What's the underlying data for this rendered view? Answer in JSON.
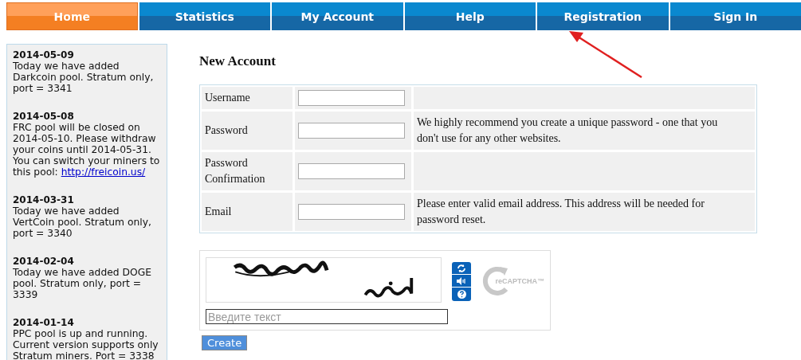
{
  "nav": [
    {
      "label": "Home",
      "selected": true
    },
    {
      "label": "Statistics",
      "selected": false
    },
    {
      "label": "My Account",
      "selected": false
    },
    {
      "label": "Help",
      "selected": false
    },
    {
      "label": "Registration",
      "selected": false
    },
    {
      "label": "Sign In",
      "selected": false
    }
  ],
  "news": [
    {
      "date": "2014-05-09",
      "text": "Today we have added Darkcoin pool. Stratum only, port = 3341"
    },
    {
      "date": "2014-05-08",
      "text": "FRC pool will be closed on 2014-05-10. Please withdraw your coins until 2014-05-31. You can switch your miners to this pool:",
      "link": "http://freicoin.us/"
    },
    {
      "date": "2014-03-31",
      "text": "Today we have added VertCoin pool. Stratum only, port = 3340"
    },
    {
      "date": "2014-02-04",
      "text": "Today we have added DOGE pool. Stratum only, port = 3339"
    },
    {
      "date": "2014-01-14",
      "text": "PPC pool is up and running. Current version supports only Stratum miners. Port = 3338"
    }
  ],
  "form": {
    "title": "New Account",
    "rows": [
      {
        "label": "Username"
      },
      {
        "label": "Password",
        "note": "We highly recommend you create a unique password - one that you don't use for any other websites."
      },
      {
        "label": "Password Confirmation"
      },
      {
        "label": "Email",
        "note": "Please enter valid email address. This address will be needed for password reset."
      }
    ],
    "captcha": {
      "placeholder": "Введите текст",
      "logo": "reCAPTCHA™"
    },
    "submit": "Create"
  }
}
